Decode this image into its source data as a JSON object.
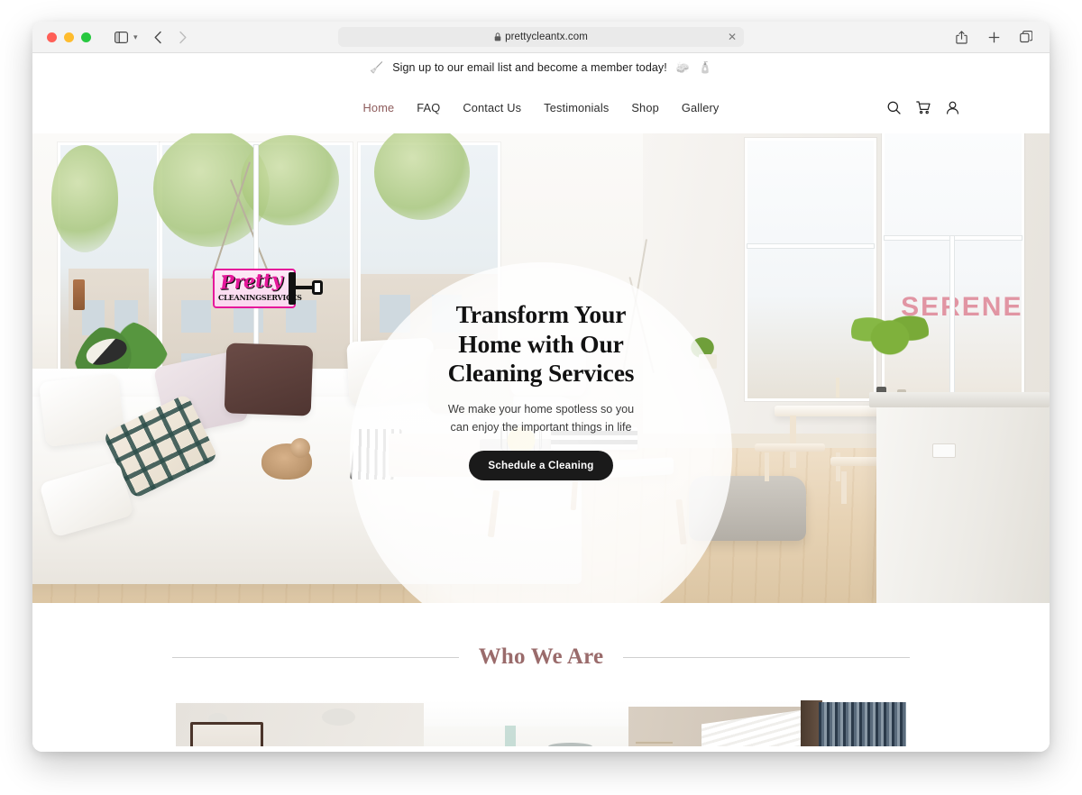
{
  "browser": {
    "window_controls": [
      "close",
      "minimize",
      "maximize"
    ],
    "sidebar_icon": "sidebar-icon",
    "back_icon": "chevron-left-icon",
    "forward_icon": "chevron-right-icon",
    "address": {
      "lock_icon": "lock-icon",
      "url": "prettycleantx.com",
      "close_icon": "close-icon"
    },
    "right_actions": [
      {
        "name": "share-icon",
        "label": "Share"
      },
      {
        "name": "new-tab-icon",
        "label": "New Tab"
      },
      {
        "name": "tab-overview-icon",
        "label": "Tab Overview"
      }
    ]
  },
  "site": {
    "announcement": {
      "left_emoji": "🧹",
      "text": "Sign up to our email list and become a member today!",
      "right_emoji_1": "🧽",
      "right_emoji_2": "🧴"
    },
    "logo": {
      "script": "Pretty",
      "subtitle": "CLEANINGSERVICES",
      "icon": "paint-roller-icon"
    },
    "nav": {
      "items": [
        {
          "label": "Home",
          "active": true
        },
        {
          "label": "FAQ",
          "active": false
        },
        {
          "label": "Contact Us",
          "active": false
        },
        {
          "label": "Testimonials",
          "active": false
        },
        {
          "label": "Shop",
          "active": false
        },
        {
          "label": "Gallery",
          "active": false
        }
      ],
      "icons": [
        {
          "name": "search-icon",
          "label": "Search"
        },
        {
          "name": "cart-icon",
          "label": "Cart"
        },
        {
          "name": "account-icon",
          "label": "Account"
        }
      ]
    },
    "hero": {
      "title_line_1": "Transform Your",
      "title_line_2": "Home with Our",
      "title_line_3": "Cleaning Services",
      "subtitle_line_1": "We make your home spotless so you",
      "subtitle_line_2": "can enjoy the important things in life",
      "cta_label": "Schedule a Cleaning",
      "image_alt": "Bright modern living room with white sofa, plants and large windows"
    },
    "who_we_are": {
      "title": "Who We Are",
      "image_alt": "Modern bathroom interior with glass shower and wood cabinetry"
    },
    "outside_sign_text": "SERENE"
  },
  "colors": {
    "accent_mauve": "#8d5b5b",
    "heading_mauve": "#9a6b6b",
    "brand_pink": "#e6189b",
    "cta_background": "#1a1a1a",
    "cta_text": "#ffffff",
    "toolbar_background": "#f3f3f3",
    "page_background": "#ffffff"
  }
}
